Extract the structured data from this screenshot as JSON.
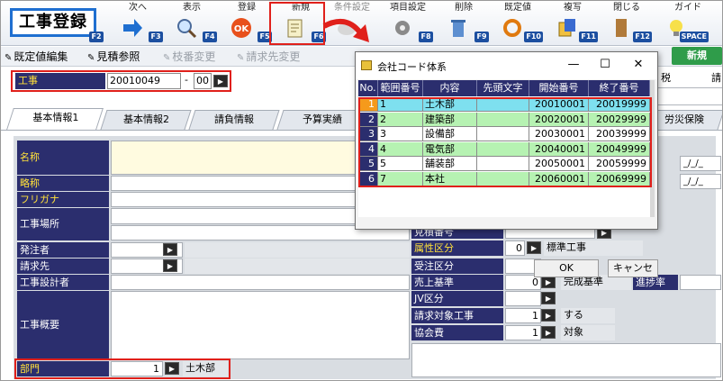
{
  "app": {
    "title": "工事登録"
  },
  "toolbar": {
    "buttons": [
      {
        "label": "次へ",
        "key": "F3"
      },
      {
        "label": "表示",
        "key": "F4"
      },
      {
        "label": "登録",
        "key": "F5"
      },
      {
        "label": "新規",
        "key": "F6"
      },
      {
        "label": "条件設定",
        "key": "F7"
      },
      {
        "label": "項目設定",
        "key": "F8"
      },
      {
        "label": "削除",
        "key": "F9"
      },
      {
        "label": "既定値",
        "key": "F10"
      },
      {
        "label": "複写",
        "key": "F11"
      },
      {
        "label": "閉じる",
        "key": "F12"
      },
      {
        "label": "ガイド",
        "key": "SPACE"
      }
    ],
    "first_key": "F2"
  },
  "bar2": {
    "items": [
      {
        "label": "既定値編集",
        "enabled": true
      },
      {
        "label": "見積参照",
        "enabled": true
      },
      {
        "label": "枝番変更",
        "enabled": false
      },
      {
        "label": "請求先変更",
        "enabled": false
      }
    ],
    "new_badge": "新規"
  },
  "koji": {
    "label": "工事",
    "code": "20010049",
    "dash": "-",
    "branch": "00"
  },
  "right_header": {
    "tax": "税",
    "req": "請"
  },
  "tabs": [
    "基本情報1",
    "基本情報2",
    "請負情報",
    "予算実績",
    "労災保険"
  ],
  "form": {
    "name_label": "名称",
    "short_label": "略称",
    "kana_label": "フリガナ",
    "place_label": "工事場所",
    "orderer_label": "発注者",
    "billing_label": "請求先",
    "designer_label": "工事設計者",
    "summary_label": "工事概要",
    "dept_label": "部門",
    "dept_code": "1",
    "dept_name": "土木部",
    "date_placeholder": "_/_/_"
  },
  "right_form": {
    "estimate_label": "見積番号",
    "attr_label": "属性区分",
    "attr_code": "0",
    "attr_name": "標準工事",
    "order_label": "受注区分",
    "sales_label": "売上基準",
    "sales_code": "0",
    "sales_name": "完成基準",
    "progress_label": "進捗率",
    "jv_label": "JV区分",
    "bill_target_label": "請求対象工事",
    "bill_target_code": "1",
    "bill_target_name": "する",
    "assoc_label": "協会費",
    "assoc_code": "1",
    "assoc_name": "対象"
  },
  "popup": {
    "title": "会社コード体系",
    "min": "—",
    "max": "☐",
    "close": "✕",
    "columns": [
      "No.",
      "範囲番号",
      "内容",
      "先頭文字",
      "開始番号",
      "終了番号"
    ],
    "rows": [
      {
        "no": "1",
        "range": "1",
        "content": "土木部",
        "prefix": "",
        "start": "20010001",
        "end": "20019999"
      },
      {
        "no": "2",
        "range": "2",
        "content": "建築部",
        "prefix": "",
        "start": "20020001",
        "end": "20029999"
      },
      {
        "no": "3",
        "range": "3",
        "content": "設備部",
        "prefix": "",
        "start": "20030001",
        "end": "20039999"
      },
      {
        "no": "4",
        "range": "4",
        "content": "電気部",
        "prefix": "",
        "start": "20040001",
        "end": "20049999"
      },
      {
        "no": "5",
        "range": "5",
        "content": "舗装部",
        "prefix": "",
        "start": "20050001",
        "end": "20059999"
      },
      {
        "no": "6",
        "range": "7",
        "content": "本社",
        "prefix": "",
        "start": "20060001",
        "end": "20069999"
      }
    ],
    "ok_label": "OK",
    "cancel_label": "キャンセ"
  },
  "colors": {
    "label_bg": "#2b2e6e",
    "label_fg": "#ffe03a",
    "row_green": "#b6f2b2",
    "row_white": "#ffffff",
    "row_selected": "#7ee0ef",
    "highlight_red": "#e0201b",
    "title_border": "#1f6fd0"
  }
}
